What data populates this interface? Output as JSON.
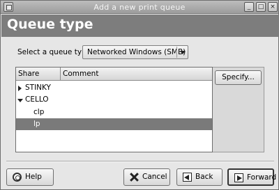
{
  "window": {
    "title": "Add a new print queue",
    "minimize_glyph": "_",
    "maximize_glyph": "□",
    "close_glyph": "×"
  },
  "header": {
    "heading": "Queue type"
  },
  "queue_type": {
    "label": "Select a queue type:",
    "selected": "Networked Windows (SMB)"
  },
  "share_list": {
    "columns": [
      "Share",
      "Comment"
    ],
    "rows": [
      {
        "name": "STINKY",
        "expander": "collapsed",
        "level": 0,
        "selected": false
      },
      {
        "name": "CELLO",
        "expander": "expanded",
        "level": 0,
        "selected": false
      },
      {
        "name": "clp",
        "expander": "none",
        "level": 1,
        "selected": false
      },
      {
        "name": "lp",
        "expander": "none",
        "level": 1,
        "selected": true
      }
    ]
  },
  "buttons": {
    "specify": "Specify...",
    "help": "Help",
    "cancel": "Cancel",
    "back": "Back",
    "forward": "Forward"
  },
  "icons": {
    "help": "help-icon",
    "cancel": "cancel-x-icon",
    "back": "back-arrow-icon",
    "forward": "forward-arrow-icon"
  },
  "colors": {
    "header_band": "#7d7d7d",
    "selected_row": "#7a7a7a",
    "window_bg": "#e6e6e6"
  }
}
